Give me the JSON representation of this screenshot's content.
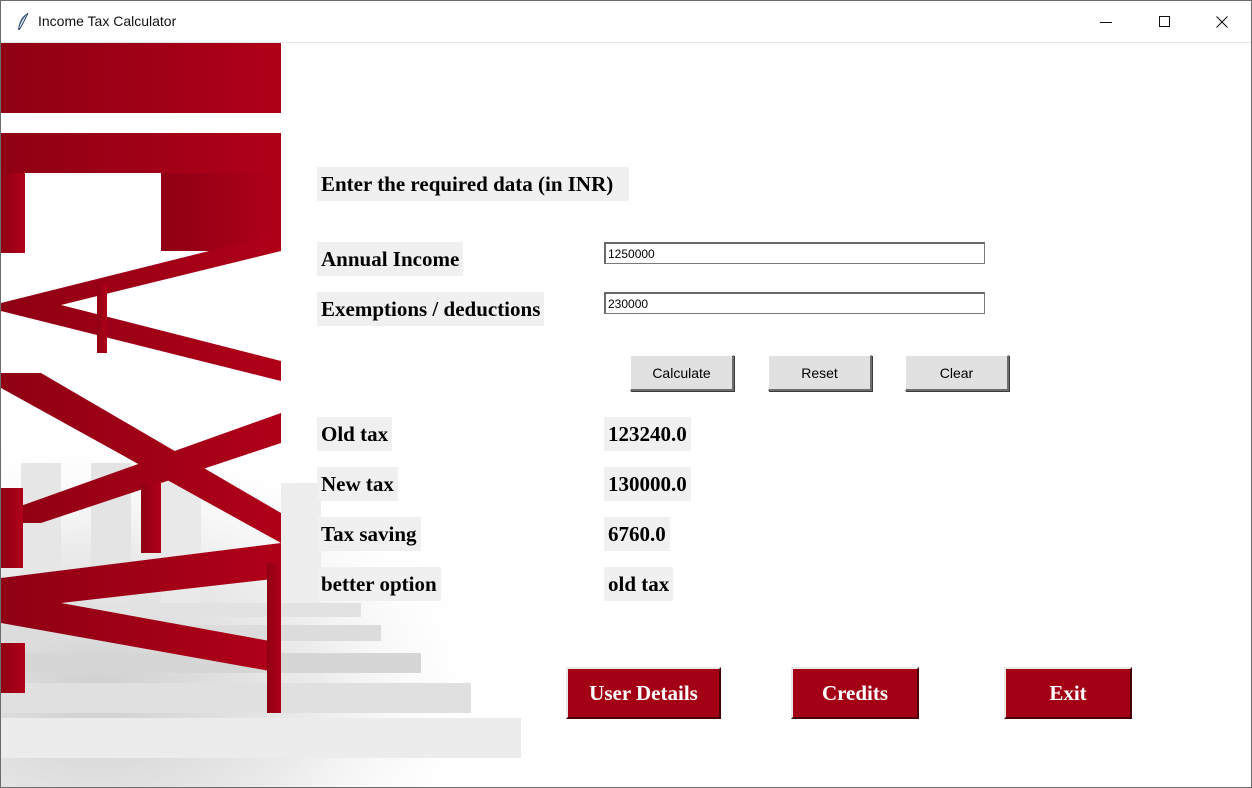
{
  "window": {
    "title": "Income Tax Calculator"
  },
  "form": {
    "heading": "Enter the required data (in INR)",
    "annual_income_label": "Annual Income",
    "annual_income_value": "1250000",
    "deductions_label": "Exemptions / deductions",
    "deductions_value": "230000"
  },
  "actions": {
    "calculate": "Calculate",
    "reset": "Reset",
    "clear": "Clear"
  },
  "results": [
    {
      "label": "Old tax",
      "value": "123240.0"
    },
    {
      "label": "New tax",
      "value": "130000.0"
    },
    {
      "label": "Tax saving",
      "value": "6760.0"
    },
    {
      "label": "better option",
      "value": "old tax"
    }
  ],
  "footer": {
    "user_details": "User Details",
    "credits": "Credits",
    "exit": "Exit"
  },
  "colors": {
    "accent_red": "#a30016",
    "label_bg": "#f0f0f0"
  }
}
